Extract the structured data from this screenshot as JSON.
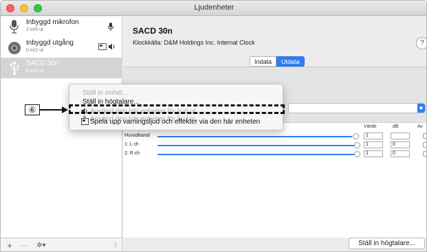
{
  "window": {
    "title": "Ljudenheter"
  },
  "sidebar": {
    "devices": [
      {
        "name": "Inbyggd mikrofon",
        "sub": "2 in/0 ut"
      },
      {
        "name": "Inbyggd utgång",
        "sub": "0 in/2 ut"
      },
      {
        "name": "SACD 30n",
        "sub": "0 in/2 ut"
      }
    ],
    "footer": {
      "add": "+",
      "remove": "—",
      "gear": "✲▾"
    }
  },
  "detail": {
    "device_title": "SACD 30n",
    "clock_label": "Klockkälla:",
    "clock_value": "D&M Holdings Inc. Internal Clock",
    "help": "?",
    "tabs": [
      {
        "label": "Indata"
      },
      {
        "label": "Utdata"
      }
    ],
    "active_tab": "Utdata"
  },
  "table": {
    "headers": {
      "value": "Värde",
      "db": "dB",
      "av": "Av"
    },
    "rows": [
      {
        "label": "Huvudkanal",
        "value": "1",
        "db": ""
      },
      {
        "label": "1: L ch",
        "value": "1",
        "db": "0"
      },
      {
        "label": "2: R ch",
        "value": "1",
        "db": "0"
      }
    ]
  },
  "context_menu": {
    "items": [
      {
        "label": "Ställ in enhet...",
        "disabled": true
      },
      {
        "label": "Ställ in högtalare...",
        "disabled": false
      },
      {
        "label": "Använd den här enheten för ljud in",
        "disabled": true,
        "icon": "microphone-icon"
      },
      {
        "label": "Använd den här enheten för ljud ut",
        "disabled": true,
        "icon": "speaker-icon"
      },
      {
        "label": "Spela upp varningsljud och effekter via den här enheten",
        "disabled": false,
        "icon": "alert-icon"
      }
    ]
  },
  "callout": {
    "number": "⑥"
  },
  "bottom": {
    "configure_speakers": "Ställ in högtalare..."
  },
  "colors": {
    "accent": "#2b7ef5"
  }
}
